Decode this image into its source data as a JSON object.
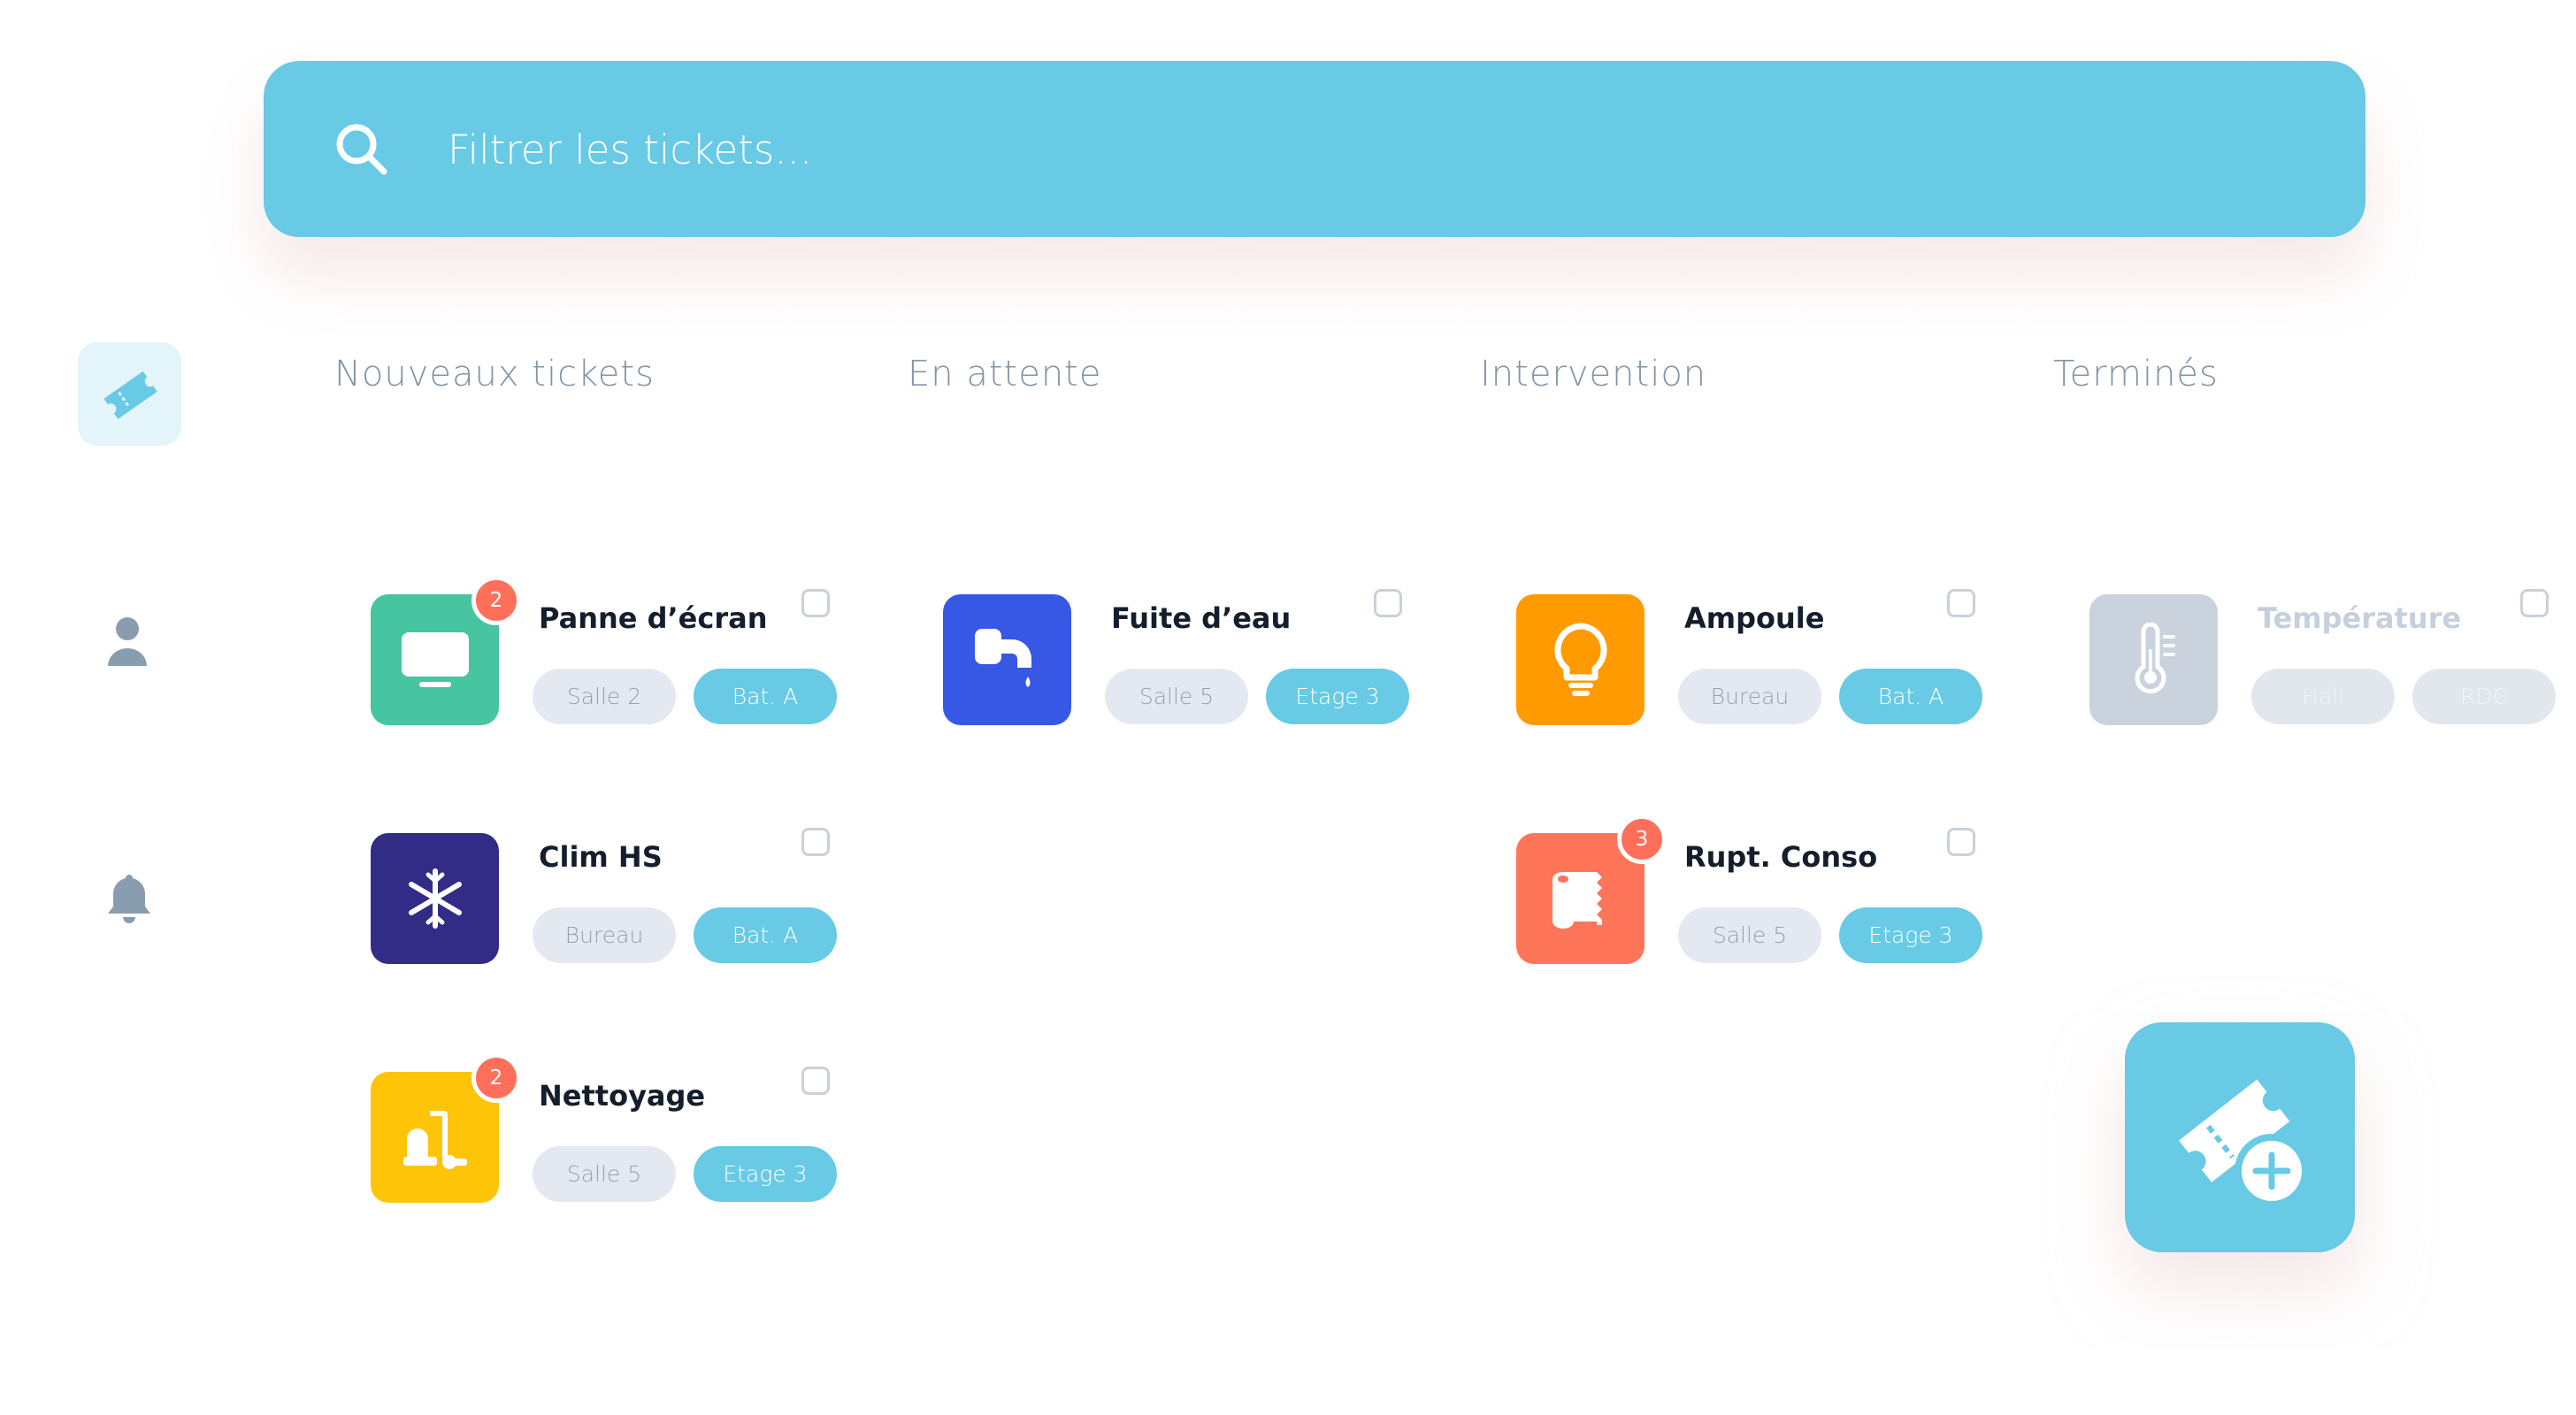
{
  "search": {
    "placeholder": "Filtrer les tickets..."
  },
  "sidebar": {
    "items": [
      "ticket-icon",
      "user-icon",
      "bell-icon"
    ],
    "active": "ticket-icon"
  },
  "columns": [
    {
      "title": "Nouveaux tickets"
    },
    {
      "title": "En attente"
    },
    {
      "title": "Intervention"
    },
    {
      "title": "Terminés"
    }
  ],
  "cards": {
    "panne": {
      "title": "Panne d’écran",
      "badge": "2",
      "tag1": "Salle 2",
      "tag2": "Bat. A",
      "icon": "monitor-icon",
      "color": "#47c4a0"
    },
    "clim": {
      "title": "Clim HS",
      "tag1": "Bureau",
      "tag2": "Bat. A",
      "icon": "snowflake-icon",
      "color": "#322c86"
    },
    "nettoyage": {
      "title": "Nettoyage",
      "badge": "2",
      "tag1": "Salle 5",
      "tag2": "Etage 3",
      "icon": "vacuum-icon",
      "color": "#fec408"
    },
    "fuite": {
      "title": "Fuite d’eau",
      "tag1": "Salle 5",
      "tag2": "Etage 3",
      "icon": "faucet-icon",
      "color": "#3658e4"
    },
    "ampoule": {
      "title": "Ampoule",
      "tag1": "Bureau",
      "tag2": "Bat. A",
      "icon": "lightbulb-icon",
      "color": "#ff9a00"
    },
    "rupt": {
      "title": "Rupt. Conso",
      "badge": "3",
      "tag1": "Salle 5",
      "tag2": "Etage 3",
      "icon": "toilet-paper-icon",
      "color": "#ff7559"
    },
    "temperature": {
      "title": "Température",
      "tag1": "Hall",
      "tag2": "RDC",
      "icon": "thermometer-icon",
      "color": "#c9d2dd"
    }
  },
  "colors": {
    "accent": "#68cae4",
    "badge": "#ff6f59",
    "muted": "#8295a6"
  },
  "fab": {
    "icon": "add-ticket-icon"
  }
}
